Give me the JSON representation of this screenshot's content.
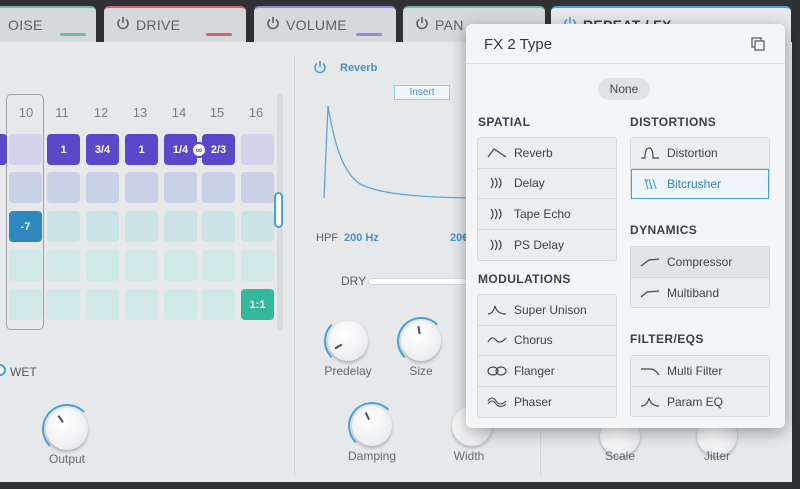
{
  "tabs": [
    {
      "label": "OISE",
      "color": "#6fb9a8"
    },
    {
      "label": "DRIVE",
      "color": "#d4636b"
    },
    {
      "label": "VOLUME",
      "color": "#9b86d6"
    },
    {
      "label": "PAN",
      "color": "#6fb9a8"
    },
    {
      "label": "REPEAT / FX",
      "color": "#4aa0d8"
    }
  ],
  "sequencer": {
    "columns": [
      "10",
      "11",
      "12",
      "13",
      "14",
      "15",
      "16"
    ],
    "row1_values": {
      "c11": "1",
      "c12": "3/4",
      "c13": "1",
      "c14": "1/4",
      "c15": "2/3"
    },
    "row3_value": "-7",
    "row5_value": "1:1",
    "wet_label": "WET",
    "output_label": "Output"
  },
  "reverb": {
    "name": "Reverb",
    "insert_label": "Insert",
    "hpf_label": "HPF",
    "hpf_value": "200 Hz",
    "lpf_value_partial": "20€",
    "dry_label": "DRY",
    "knobs": [
      "Predelay",
      "Size",
      "Damping",
      "Width"
    ]
  },
  "right_knobs": [
    "Scale",
    "Jitter"
  ],
  "popup": {
    "title": "FX 2 Type",
    "none_label": "None",
    "sections": {
      "spatial": {
        "title": "SPATIAL",
        "items": [
          "Reverb",
          "Delay",
          "Tape Echo",
          "PS Delay"
        ]
      },
      "modulations": {
        "title": "MODULATIONS",
        "items": [
          "Super Unison",
          "Chorus",
          "Flanger",
          "Phaser"
        ]
      },
      "distortions": {
        "title": "DISTORTIONS",
        "items": [
          "Distortion",
          "Bitcrusher"
        ]
      },
      "dynamics": {
        "title": "DYNAMICS",
        "items": [
          "Compressor",
          "Multiband"
        ]
      },
      "filters": {
        "title": "FILTER/EQS",
        "items": [
          "Multi Filter",
          "Param EQ"
        ]
      }
    },
    "selected": "Bitcrusher"
  },
  "colors": {
    "accent": "#4aa0d8",
    "active_step": "#5a47c9"
  }
}
